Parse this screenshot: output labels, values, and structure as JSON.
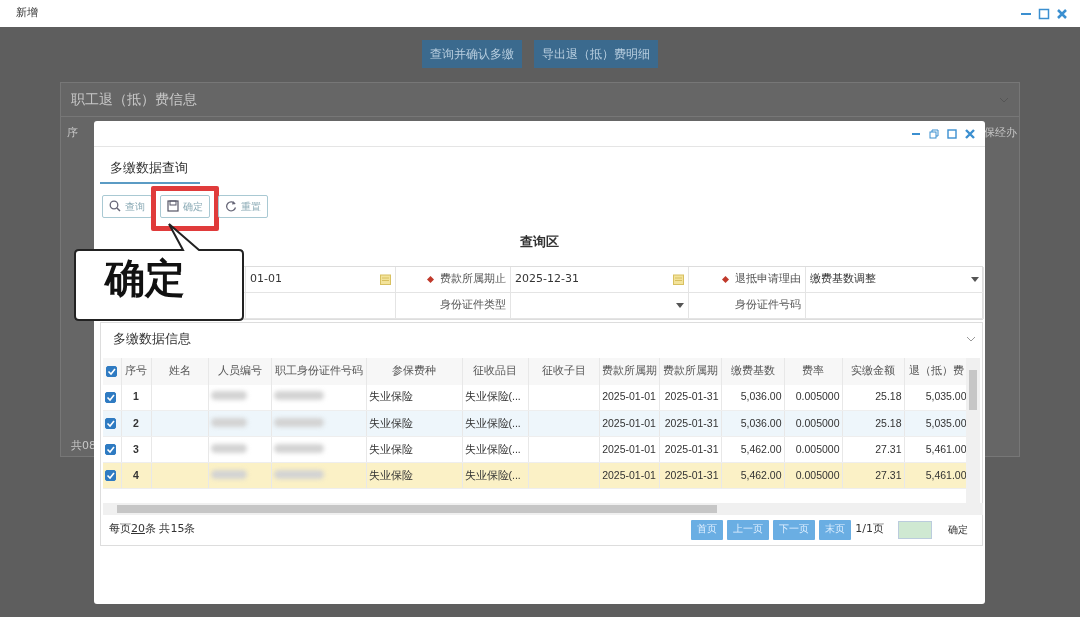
{
  "window": {
    "title": "新增"
  },
  "background": {
    "buttons": [
      "查询并确认多缴",
      "导出退（抵）费明细"
    ],
    "panel_title": "职工退（抵）费信息",
    "column_1": "序",
    "column_last": "保经办",
    "footer": "共08"
  },
  "dialog": {
    "tab": {
      "label": "多缴数据查询",
      "selected": true
    },
    "toolbar": [
      {
        "label": "查询",
        "kind": "search",
        "highlighted": false
      },
      {
        "label": "确定",
        "kind": "save",
        "highlighted": true
      },
      {
        "label": "重置",
        "kind": "reset",
        "highlighted": false
      }
    ],
    "callout": {
      "text": "确定"
    },
    "query_title": "查询区",
    "fields": [
      {
        "kind": "date",
        "required": false,
        "value": "01-01"
      },
      {
        "kind": "date",
        "required": true,
        "label": "费款所属期止",
        "value": "2025-12-31"
      },
      {
        "kind": "select",
        "required": true,
        "label": "退抵申请理由",
        "value": "缴费基数调整"
      },
      {
        "kind": "text",
        "required": false
      },
      {
        "kind": "select",
        "required": false,
        "label": "身份证件类型"
      },
      {
        "kind": "text",
        "required": false,
        "label": "身份证件号码"
      }
    ],
    "section_title": "多缴数据信息",
    "table": {
      "all_checked": true,
      "columns": [
        "序号",
        "姓名",
        "人员编号",
        "职工身份证件号码",
        "参保费种",
        "征收品目",
        "征收子目",
        "费款所属期",
        "费款所属期",
        "缴费基数",
        "费率",
        "实缴金额",
        "退（抵）费"
      ],
      "rows": [
        {
          "checked": true,
          "selected": false,
          "hovered": false,
          "cells": [
            "1",
            null,
            null,
            null,
            "失业保险",
            "失业保险(...",
            "",
            "2025-01-01",
            "2025-01-31",
            "5,036.00",
            "0.005000",
            "25.18",
            "5,035.00"
          ]
        },
        {
          "checked": true,
          "selected": false,
          "hovered": true,
          "cells": [
            "2",
            null,
            null,
            null,
            "失业保险",
            "失业保险(...",
            "",
            "2025-01-01",
            "2025-01-31",
            "5,036.00",
            "0.005000",
            "25.18",
            "5,035.00"
          ]
        },
        {
          "checked": true,
          "selected": false,
          "hovered": false,
          "cells": [
            "3",
            null,
            null,
            null,
            "失业保险",
            "失业保险(...",
            "",
            "2025-01-01",
            "2025-01-31",
            "5,462.00",
            "0.005000",
            "27.31",
            "5,461.00"
          ]
        },
        {
          "checked": true,
          "selected": true,
          "hovered": false,
          "cells": [
            "4",
            null,
            null,
            null,
            "失业保险",
            "失业保险(...",
            "",
            "2025-01-01",
            "2025-01-31",
            "5,462.00",
            "0.005000",
            "27.31",
            "5,461.00"
          ]
        }
      ]
    },
    "pager": {
      "per_page_before": "每页",
      "per_page": "20",
      "per_page_after": "条 共15条",
      "buttons": [
        "首页",
        "上一页",
        "下一页",
        "末页"
      ],
      "page_info": "1/1页",
      "go_button": "确定"
    }
  }
}
